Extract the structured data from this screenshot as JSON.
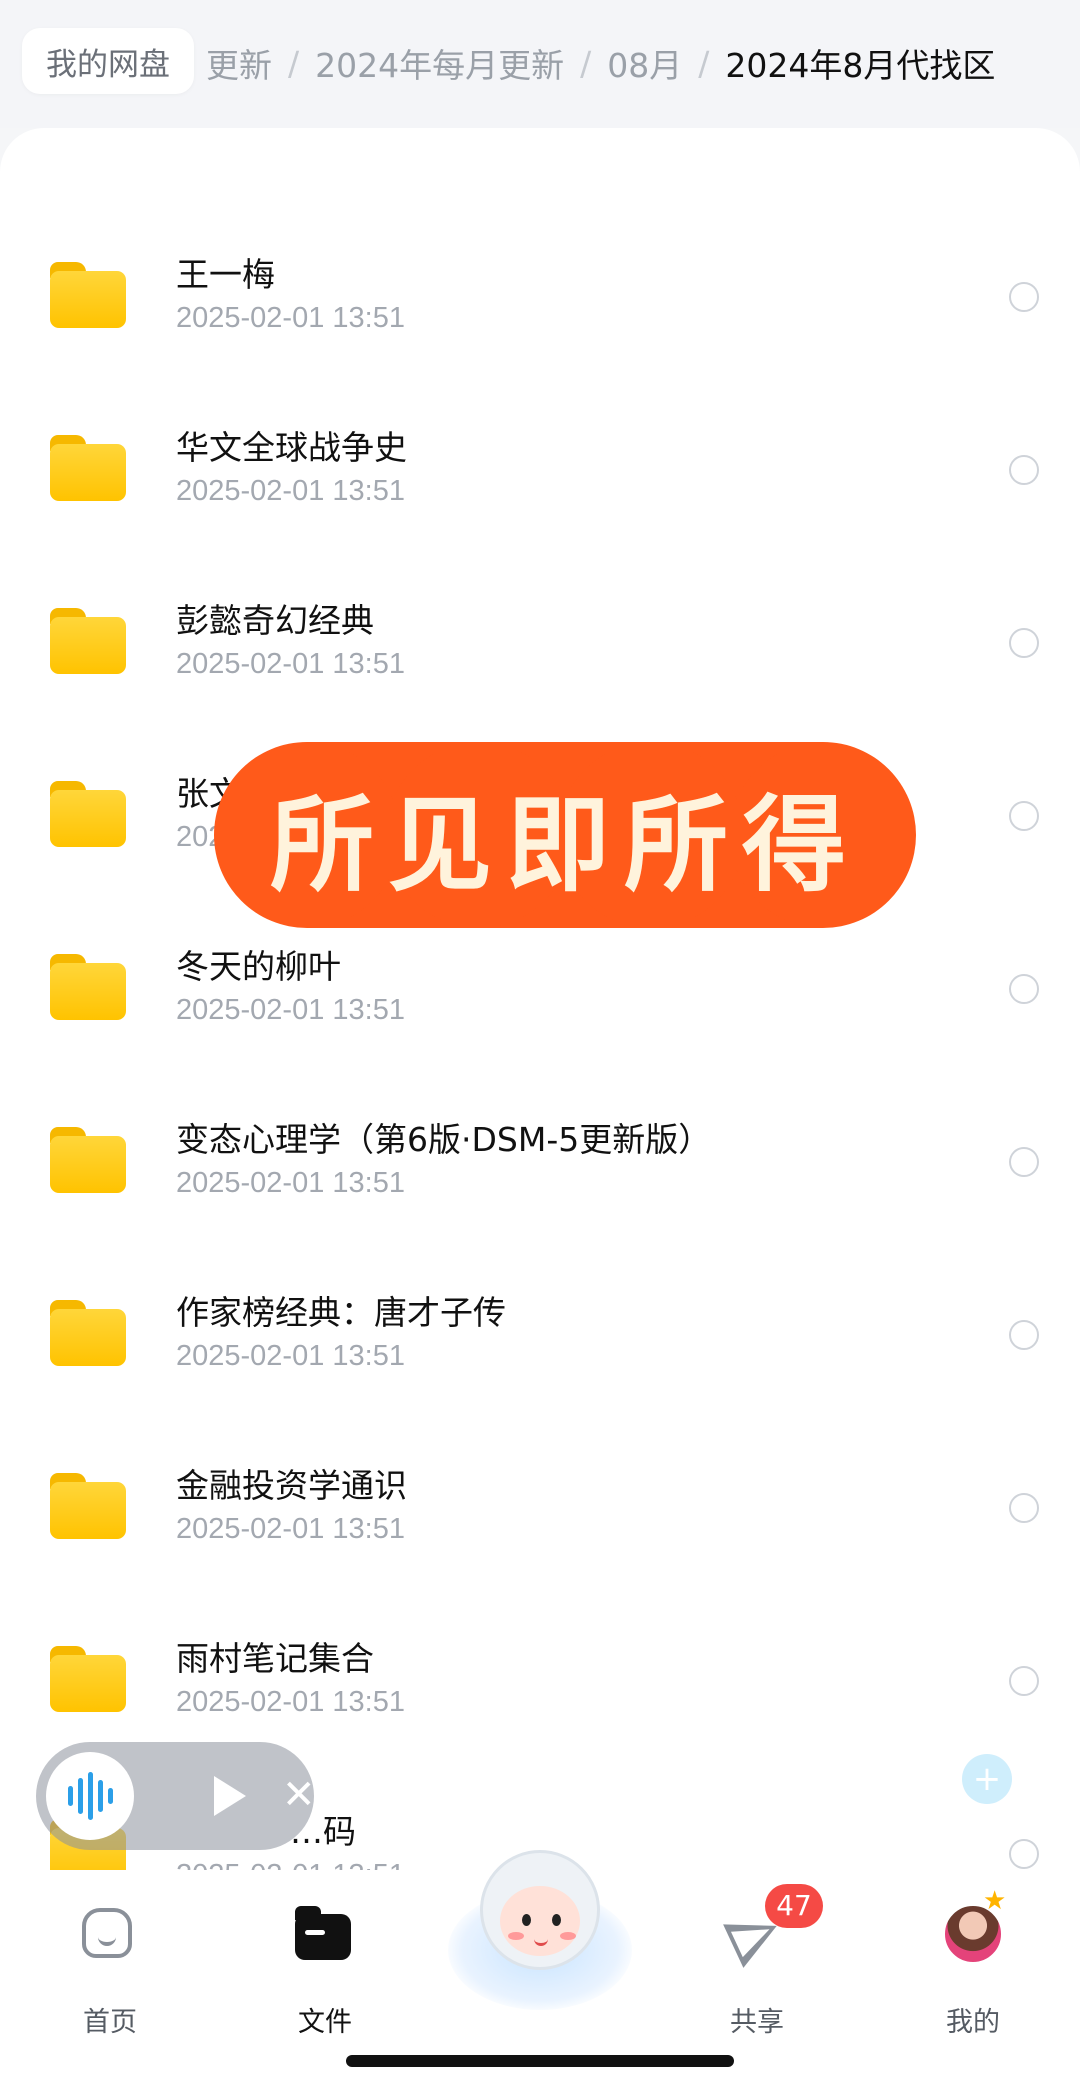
{
  "header": {
    "root_label": "我的网盘",
    "breadcrumb": [
      "更新",
      "2024年每月更新",
      "08月",
      "2024年8月代找区"
    ],
    "separator": "/"
  },
  "files": [
    {
      "name": "王一梅",
      "date": "2025-02-01 13:51"
    },
    {
      "name": "华文全球战争史",
      "date": "2025-02-01 13:51"
    },
    {
      "name": "彭懿奇幻经典",
      "date": "2025-02-01 13:51"
    },
    {
      "name": "张文鹤书法指南",
      "date": "2025-02-01 13:51"
    },
    {
      "name": "冬天的柳叶",
      "date": "2025-02-01 13:51"
    },
    {
      "name": "变态心理学（第6版·DSM-5更新版）",
      "date": "2025-02-01 13:51"
    },
    {
      "name": "作家榜经典：唐才子传",
      "date": "2025-02-01 13:51"
    },
    {
      "name": "金融投资学通识",
      "date": "2025-02-01 13:51"
    },
    {
      "name": "雨村笔记集合",
      "date": "2025-02-01 13:51"
    },
    {
      "name": "…码",
      "date": "2025-02-01 13:51"
    }
  ],
  "banner": {
    "text": "所见即所得",
    "color": "#ff5a1a"
  },
  "player": {
    "wave_icon": "audio-wave-icon",
    "play_icon": "play-icon",
    "close_label": "✕"
  },
  "fab": {
    "label": "+"
  },
  "nav": {
    "items": [
      {
        "label": "首页",
        "icon": "home-icon"
      },
      {
        "label": "文件",
        "icon": "folder-icon",
        "active": true
      },
      {
        "label": "",
        "icon": "mascot-icon"
      },
      {
        "label": "共享",
        "icon": "share-icon",
        "badge": "47"
      },
      {
        "label": "我的",
        "icon": "avatar"
      }
    ]
  },
  "colors": {
    "folder": "#ffc300",
    "badge": "#f54a45",
    "accent": "#2b9fe8"
  }
}
